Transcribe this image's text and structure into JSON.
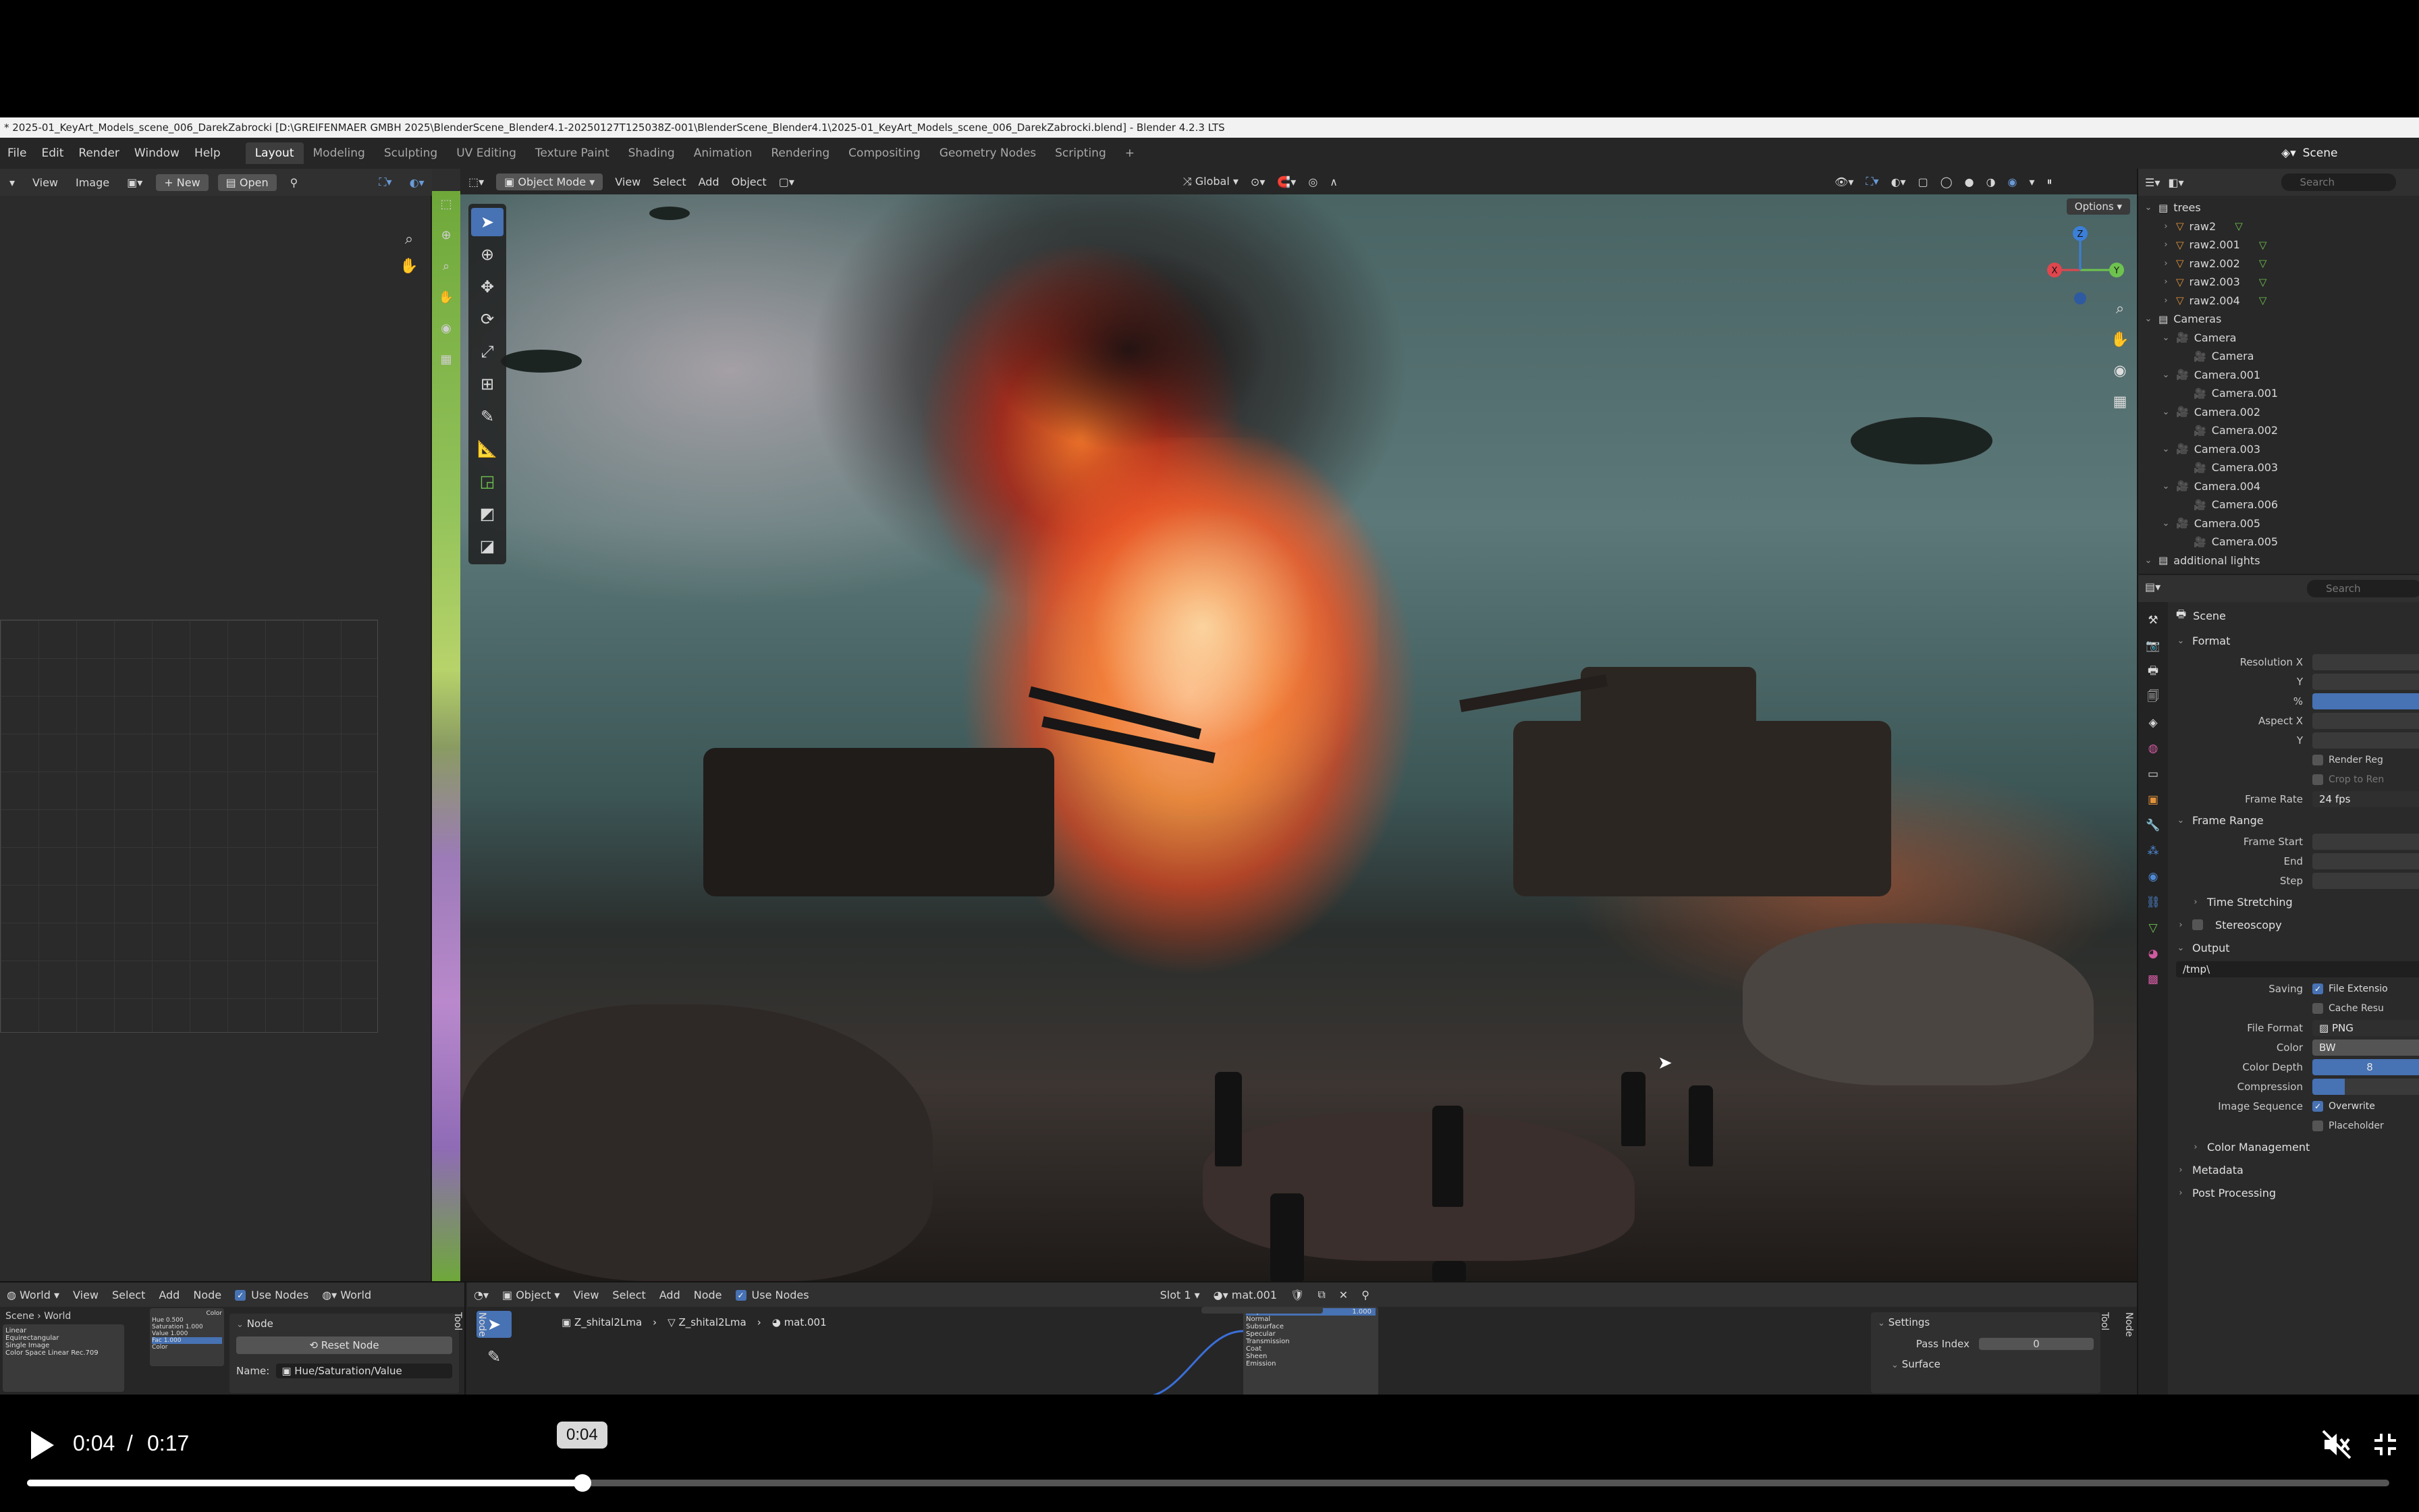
{
  "window": {
    "title": "* 2025-01_KeyArt_Models_scene_006_DarekZabrocki [D:\\GREIFENMAER GMBH 2025\\BlenderScene_Blender4.1-20250127T125038Z-001\\BlenderScene_Blender4.1\\2025-01_KeyArt_Models_scene_006_DarekZabrocki.blend] - Blender 4.2.3 LTS"
  },
  "menu": {
    "items": [
      "File",
      "Edit",
      "Render",
      "Window",
      "Help"
    ],
    "workspaces": [
      "Layout",
      "Modeling",
      "Sculpting",
      "UV Editing",
      "Texture Paint",
      "Shading",
      "Animation",
      "Rendering",
      "Compositing",
      "Geometry Nodes",
      "Scripting"
    ],
    "add_tab": "+",
    "active_workspace": "Layout",
    "scene_name": "Scene"
  },
  "image_editor": {
    "view": "View",
    "image": "Image",
    "new": "New",
    "open": "Open"
  },
  "viewport": {
    "mode": "Object Mode",
    "menus": [
      "View",
      "Select",
      "Add",
      "Object"
    ],
    "transform": "Global",
    "options": "Options",
    "gizmo_axes": {
      "x": "X",
      "y": "Y",
      "z": "Z"
    }
  },
  "outliner": {
    "search_placeholder": "Search",
    "rows": [
      {
        "indent": 0,
        "type": "collection",
        "name": "trees"
      },
      {
        "indent": 1,
        "type": "mesh",
        "name": "raw2"
      },
      {
        "indent": 1,
        "type": "mesh",
        "name": "raw2.001"
      },
      {
        "indent": 1,
        "type": "mesh",
        "name": "raw2.002"
      },
      {
        "indent": 1,
        "type": "mesh",
        "name": "raw2.003"
      },
      {
        "indent": 1,
        "type": "mesh",
        "name": "raw2.004"
      },
      {
        "indent": 0,
        "type": "collection",
        "name": "Cameras"
      },
      {
        "indent": 1,
        "type": "camera",
        "name": "Camera"
      },
      {
        "indent": 2,
        "type": "camdata",
        "name": "Camera"
      },
      {
        "indent": 1,
        "type": "camera",
        "name": "Camera.001"
      },
      {
        "indent": 2,
        "type": "camdata",
        "name": "Camera.001"
      },
      {
        "indent": 1,
        "type": "camera",
        "name": "Camera.002"
      },
      {
        "indent": 2,
        "type": "camdata",
        "name": "Camera.002"
      },
      {
        "indent": 1,
        "type": "camera",
        "name": "Camera.003"
      },
      {
        "indent": 2,
        "type": "camdata",
        "name": "Camera.003"
      },
      {
        "indent": 1,
        "type": "camera",
        "name": "Camera.004"
      },
      {
        "indent": 2,
        "type": "camdata",
        "name": "Camera.006"
      },
      {
        "indent": 1,
        "type": "camera",
        "name": "Camera.005"
      },
      {
        "indent": 2,
        "type": "camdata",
        "name": "Camera.005"
      },
      {
        "indent": 0,
        "type": "collection",
        "name": "additional lights"
      }
    ]
  },
  "properties": {
    "search_placeholder": "Search",
    "context": "Scene",
    "format": {
      "title": "Format",
      "resolution_x": "Resolution X",
      "y": "Y",
      "percent": "%",
      "aspect_x": "Aspect X",
      "aspect_y": "Y",
      "render_region": "Render Reg",
      "crop": "Crop to Ren",
      "frame_rate_label": "Frame Rate",
      "frame_rate": "24 fps"
    },
    "frame_range": {
      "title": "Frame Range",
      "start": "Frame Start",
      "end": "End",
      "step": "Step",
      "time_stretching": "Time Stretching"
    },
    "stereoscopy": "Stereoscopy",
    "output": {
      "title": "Output",
      "path": "/tmp\\",
      "saving": "Saving",
      "file_extensions": "File Extensio",
      "cache_result": "Cache Resu",
      "file_format_label": "File Format",
      "file_format": "PNG",
      "color_label": "Color",
      "color": "BW",
      "color_depth_label": "Color Depth",
      "color_depth": "8",
      "compression_label": "Compression",
      "image_sequence_label": "Image Sequence",
      "overwrite": "Overwrite",
      "placeholders": "Placeholder",
      "color_management": "Color Management"
    },
    "metadata": "Metadata",
    "post_processing": "Post Processing"
  },
  "world_editor": {
    "type": "World",
    "menus": [
      "View",
      "Select",
      "Add",
      "Node"
    ],
    "use_nodes": "Use Nodes",
    "world_name": "World",
    "breadcrumb_scene": "Scene",
    "breadcrumb_world": "World",
    "node_panel_title": "Node",
    "reset_node": "Reset Node",
    "name_label": "Name:",
    "name_value": "Hue/Saturation/Value",
    "node_tab": "Node",
    "tool_tab": "Tool",
    "mini_labels": [
      "Linear",
      "Equirectangular",
      "Single Image",
      "Color Space"
    ],
    "mini_color_space": "Linear Rec.709",
    "hsv_rows": [
      {
        "label": "Hue",
        "value": "0.500"
      },
      {
        "label": "Saturation",
        "value": "1.000"
      },
      {
        "label": "Value",
        "value": "1.000"
      },
      {
        "label": "Fac",
        "value": "1.000"
      }
    ],
    "hsv_color_in": "Color",
    "hsv_color_out": "Color"
  },
  "shader_editor": {
    "type": "Object",
    "menus": [
      "View",
      "Select",
      "Add",
      "Node"
    ],
    "use_nodes": "Use Nodes",
    "slot": "Slot 1",
    "material": "mat.001",
    "breadcrumb": [
      "Z_shital2Lma",
      "Z_shital2Lma",
      "mat.001"
    ],
    "settings": "Settings",
    "pass_index_label": "Pass Index",
    "pass_index": "0",
    "surface": "Surface",
    "node_tab": "Node",
    "tool_tab": "Tool",
    "bsdf_top": {
      "label": "Alpha",
      "value": "1.000"
    },
    "bsdf_rows": [
      "Normal",
      "Subsurface",
      "Specular",
      "Transmission",
      "Coat",
      "Sheen",
      "Emission"
    ]
  },
  "video": {
    "current": "0:04",
    "separator": "/",
    "total": "0:17",
    "tooltip": "0:04",
    "progress": 0.235
  }
}
